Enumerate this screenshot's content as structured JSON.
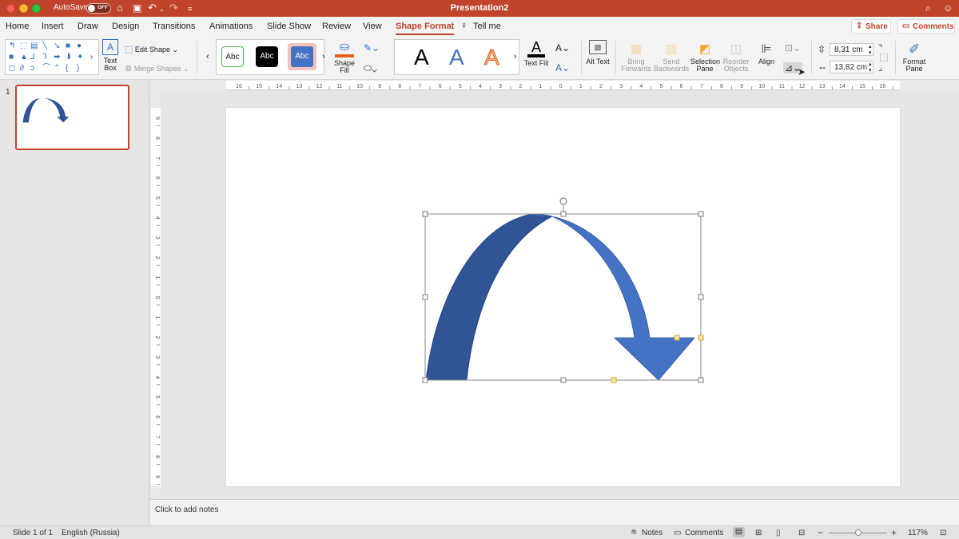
{
  "titlebar": {
    "autosave_label": "AutoSave",
    "autosave_state": "OFF",
    "document_title": "Presentation2",
    "color": "#c0432b"
  },
  "tabs": [
    {
      "label": "Home"
    },
    {
      "label": "Insert"
    },
    {
      "label": "Draw"
    },
    {
      "label": "Design"
    },
    {
      "label": "Transitions"
    },
    {
      "label": "Animations"
    },
    {
      "label": "Slide Show"
    },
    {
      "label": "Review"
    },
    {
      "label": "View"
    },
    {
      "label": "Shape Format",
      "active": true
    },
    {
      "label": "Tell me"
    }
  ],
  "actions": {
    "share_label": "Share",
    "comments_label": "Comments"
  },
  "ribbon": {
    "text_box_label": "Text Box",
    "edit_shape_label": "Edit Shape",
    "merge_shapes_label": "Merge Shapes",
    "style_samples": [
      "Abc",
      "Abc",
      "Abc"
    ],
    "shape_fill_label": "Shape Fill",
    "wordart_samples": [
      "A",
      "A",
      "A"
    ],
    "text_fill_label": "Text Fill",
    "alt_text_label": "Alt Text",
    "bring_forwards_label": "Bring Forwards",
    "send_backwards_label": "Send Backwards",
    "selection_pane_label": "Selection Pane",
    "reorder_objects_label": "Reorder Objects",
    "align_label": "Align",
    "height_value": "8,31 cm",
    "width_value": "13,82 cm",
    "format_pane_label": "Format Pane"
  },
  "ruler": {
    "h_ticks": [
      "16",
      "15",
      "14",
      "13",
      "12",
      "11",
      "10",
      "9",
      "8",
      "7",
      "6",
      "5",
      "4",
      "3",
      "2",
      "1",
      "0",
      "1",
      "2",
      "3",
      "4",
      "5",
      "6",
      "7",
      "8",
      "9",
      "10",
      "11",
      "12",
      "13",
      "14",
      "15",
      "16"
    ],
    "v_ticks": [
      "9",
      "8",
      "7",
      "6",
      "5",
      "4",
      "3",
      "2",
      "1",
      "0",
      "1",
      "2",
      "3",
      "4",
      "5",
      "6",
      "7",
      "8",
      "9"
    ]
  },
  "thumbnails": [
    {
      "number": "1"
    }
  ],
  "notes": {
    "placeholder": "Click to add notes"
  },
  "status": {
    "slide_info": "Slide 1 of 1",
    "language": "English (Russia)",
    "notes_label": "Notes",
    "comments_label": "Comments",
    "zoom_minus": "−",
    "zoom_plus": "+",
    "zoom_level": "117%",
    "zoom_fraction": 0.5
  },
  "shape": {
    "fill_dark": "#2f5597",
    "fill_light": "#4472c4"
  }
}
